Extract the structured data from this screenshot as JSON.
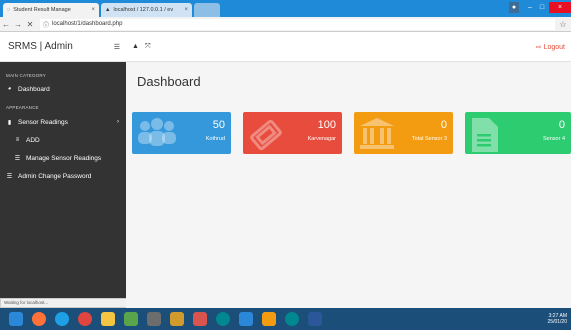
{
  "browser": {
    "tabs": [
      {
        "label": "Student Result Manage"
      },
      {
        "label": "localhost / 127.0.0.1 / ev"
      }
    ],
    "url": "localhost/1/dashboard.php",
    "status_text": "Waiting for localhost..."
  },
  "header": {
    "brand": "SRMS | Admin",
    "logout_label": "Logout"
  },
  "sidebar": {
    "main_category": "MAIN CATEGORY",
    "appearance": "APPEARANCE",
    "items": [
      {
        "label": "Dashboard"
      },
      {
        "label": "Sensor Readings"
      },
      {
        "label": "ADD"
      },
      {
        "label": "Manage Sensor Readings"
      },
      {
        "label": "Admin Change Password"
      }
    ]
  },
  "main": {
    "title": "Dashboard",
    "cards": [
      {
        "value": "50",
        "label": "Kothrud",
        "color": "#3498db",
        "icon": "users-icon"
      },
      {
        "value": "100",
        "label": "Karvenagar",
        "color": "#e74c3c",
        "icon": "ticket-icon"
      },
      {
        "value": "0",
        "label": "Total Sensor 3",
        "color": "#f39c12",
        "icon": "bank-icon"
      },
      {
        "value": "0",
        "label": "Sensor 4",
        "color": "#2ecc71",
        "icon": "file-icon"
      }
    ]
  },
  "taskbar": {
    "time": "3:27 AM",
    "date": "25/01/20"
  }
}
